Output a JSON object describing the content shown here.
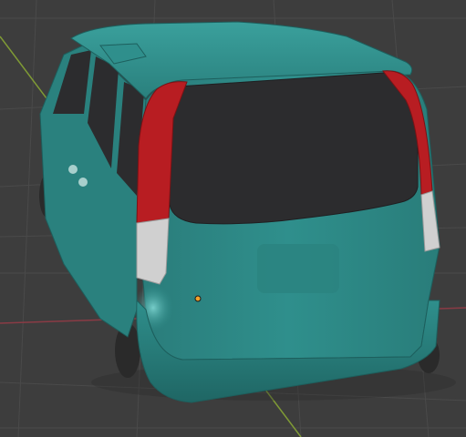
{
  "viewport": {
    "background_color": "#3d3d3d",
    "grid_line_color": "#4a4a4a",
    "x_axis_color": "#8a3b45",
    "y_axis_color": "#7f9a35"
  },
  "scene": {
    "object": "car-model",
    "body_color": "#2f8f8c",
    "body_shadow_color": "#1c5e5c",
    "window_color": "#2c2c2e",
    "tail_light_color": "#b81d22",
    "tail_light_lower_color": "#d0d0d0",
    "tire_color": "#2a2a2a",
    "origin_marker_color": "#f2a12b"
  }
}
